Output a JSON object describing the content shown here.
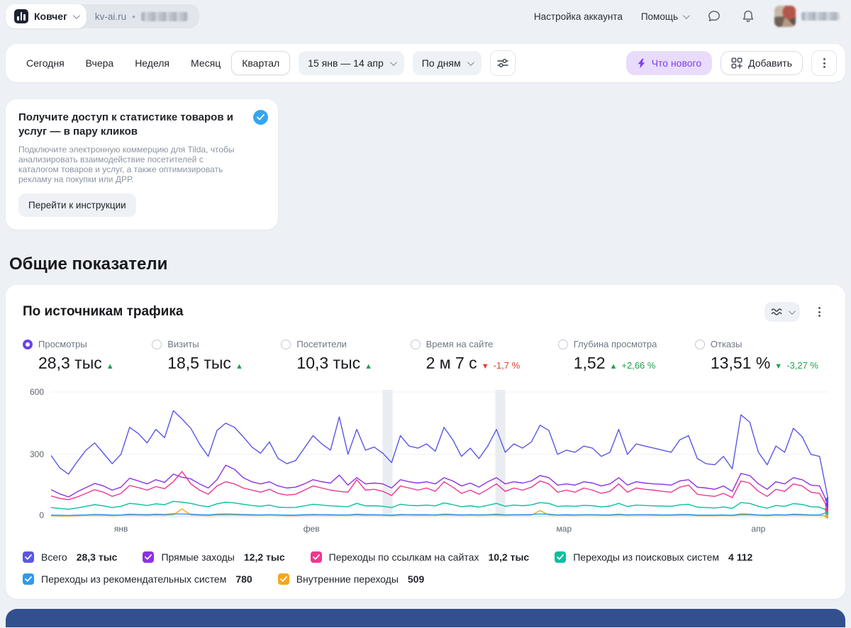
{
  "header": {
    "counter_name": "Ковчег",
    "site_url": "kv-ai.ru",
    "separator": "•",
    "account_settings_label": "Настройка аккаунта",
    "help_label": "Помощь"
  },
  "toolbar": {
    "periods": [
      "Сегодня",
      "Вчера",
      "Неделя",
      "Месяц",
      "Квартал"
    ],
    "selected_period": "Квартал",
    "date_range_label": "15 янв — 14 апр",
    "granularity_label": "По дням",
    "whats_new_label": "Что нового",
    "add_label": "Добавить"
  },
  "promo": {
    "title": "Получите доступ к статистике товаров и услуг — в пару кликов",
    "body": "Подключите электронную коммерцию для Tilda, чтобы анализировать взаимодействие посетителей с каталогом товаров и услуг, а также оптимизировать рекламу на покупки или ДРР.",
    "cta_label": "Перейти к инструкции"
  },
  "section_title": "Общие показатели",
  "chart_card": {
    "title": "По источникам трафика",
    "metrics": [
      {
        "label": "Просмотры",
        "value": "28,3 тыс",
        "arrow": "▲",
        "delta": ""
      },
      {
        "label": "Визиты",
        "value": "18,5 тыс",
        "arrow": "▲",
        "delta": ""
      },
      {
        "label": "Посетители",
        "value": "10,3 тыс",
        "arrow": "▲",
        "delta": ""
      },
      {
        "label": "Время на сайте",
        "value": "2 м 7 с",
        "arrow": "▼",
        "delta": "-1,7 %"
      },
      {
        "label": "Глубина просмотра",
        "value": "1,52",
        "arrow": "▲",
        "delta": "+2,66 %"
      },
      {
        "label": "Отказы",
        "value": "13,51 %",
        "arrow": "▼",
        "delta": "-3,27 %"
      }
    ],
    "legend": [
      {
        "label": "Всего",
        "value": "28,3 тыс",
        "color": "#5b57e8"
      },
      {
        "label": "Прямые заходы",
        "value": "12,2 тыс",
        "color": "#8c32e3"
      },
      {
        "label": "Переходы по ссылкам на сайтах",
        "value": "10,2 тыс",
        "color": "#f0368f"
      },
      {
        "label": "Переходы из поисковых систем",
        "value": "4 112",
        "color": "#0cbf9f"
      },
      {
        "label": "Переходы из рекомендательных систем",
        "value": "780",
        "color": "#2d9bf0"
      },
      {
        "label": "Внутренние переходы",
        "value": "509",
        "color": "#f5a71f"
      }
    ]
  },
  "chart_data": {
    "type": "line",
    "title": "По источникам трафика",
    "x_range": "15 янв — 14 апр, по дням",
    "ylim": [
      0,
      600
    ],
    "yticks": [
      600,
      300,
      0
    ],
    "xticks": [
      "янв",
      "фев",
      "мар",
      "апр"
    ],
    "xtick_fracs": [
      0.09,
      0.335,
      0.66,
      0.91
    ],
    "holiday_band_fracs": [
      0.433,
      0.578
    ],
    "grid": true,
    "legend_position": "bottom",
    "series": [
      {
        "name": "Всего",
        "total": "28,3 тыс",
        "color": "#5b57e8",
        "values": [
          295,
          235,
          205,
          265,
          320,
          355,
          305,
          255,
          300,
          430,
          400,
          355,
          420,
          380,
          510,
          470,
          425,
          350,
          290,
          415,
          450,
          430,
          385,
          335,
          305,
          360,
          280,
          255,
          270,
          330,
          390,
          350,
          320,
          480,
          300,
          420,
          320,
          335,
          305,
          260,
          390,
          340,
          330,
          350,
          315,
          430,
          370,
          290,
          330,
          280,
          340,
          420,
          310,
          350,
          330,
          360,
          440,
          415,
          300,
          320,
          310,
          340,
          330,
          290,
          310,
          420,
          300,
          350,
          340,
          330,
          320,
          310,
          370,
          390,
          280,
          255,
          250,
          290,
          230,
          490,
          455,
          310,
          250,
          340,
          310,
          425,
          385,
          300,
          290,
          80
        ]
      },
      {
        "name": "Прямые заходы",
        "total": "12,2 тыс",
        "color": "#8c32e3",
        "values": [
          130,
          110,
          95,
          120,
          140,
          160,
          148,
          128,
          142,
          185,
          172,
          158,
          178,
          165,
          205,
          190,
          182,
          158,
          138,
          178,
          248,
          228,
          188,
          168,
          158,
          168,
          148,
          138,
          142,
          158,
          178,
          168,
          162,
          200,
          152,
          188,
          158,
          162,
          158,
          138,
          178,
          168,
          162,
          168,
          158,
          188,
          172,
          148,
          162,
          142,
          168,
          188,
          158,
          168,
          162,
          172,
          198,
          188,
          152,
          158,
          152,
          168,
          162,
          148,
          158,
          188,
          152,
          168,
          162,
          158,
          156,
          152,
          172,
          178,
          142,
          138,
          132,
          148,
          122,
          208,
          198,
          158,
          132,
          168,
          158,
          188,
          178,
          152,
          148,
          58
        ]
      },
      {
        "name": "Переходы по ссылкам на сайтах",
        "total": "10,2 тыс",
        "color": "#f0368f",
        "values": [
          100,
          88,
          82,
          95,
          112,
          130,
          118,
          98,
          112,
          150,
          140,
          128,
          145,
          135,
          168,
          218,
          158,
          128,
          108,
          148,
          168,
          158,
          138,
          128,
          118,
          132,
          112,
          104,
          108,
          128,
          148,
          138,
          128,
          122,
          118,
          178,
          128,
          132,
          122,
          102,
          148,
          138,
          128,
          138,
          122,
          168,
          142,
          112,
          128,
          108,
          132,
          158,
          122,
          138,
          128,
          142,
          172,
          158,
          118,
          128,
          118,
          138,
          128,
          112,
          122,
          158,
          118,
          138,
          132,
          128,
          122,
          118,
          142,
          152,
          108,
          102,
          98,
          112,
          92,
          172,
          162,
          122,
          98,
          132,
          122,
          158,
          148,
          118,
          112,
          38
        ]
      },
      {
        "name": "Переходы из поисковых систем",
        "total": "4 112",
        "color": "#0cbf9f",
        "values": [
          44,
          40,
          36,
          42,
          50,
          58,
          52,
          44,
          50,
          64,
          60,
          54,
          62,
          58,
          74,
          70,
          64,
          54,
          48,
          62,
          70,
          66,
          60,
          54,
          50,
          56,
          46,
          44,
          45,
          52,
          60,
          56,
          52,
          50,
          48,
          64,
          52,
          53,
          50,
          44,
          60,
          55,
          53,
          56,
          52,
          66,
          58,
          48,
          53,
          46,
          55,
          64,
          50,
          56,
          53,
          57,
          68,
          64,
          49,
          52,
          50,
          55,
          53,
          47,
          51,
          64,
          49,
          56,
          54,
          52,
          51,
          50,
          57,
          60,
          46,
          44,
          42,
          47,
          40,
          68,
          64,
          50,
          41,
          54,
          50,
          63,
          59,
          48,
          46,
          28
        ]
      },
      {
        "name": "Переходы из рекомендательных систем",
        "total": "780",
        "color": "#2d9bf0",
        "values": [
          8,
          7,
          6,
          8,
          9,
          11,
          10,
          8,
          9,
          12,
          11,
          10,
          12,
          11,
          14,
          13,
          12,
          10,
          9,
          12,
          13,
          12,
          11,
          10,
          9,
          10,
          9,
          8,
          8,
          10,
          11,
          10,
          10,
          9,
          9,
          12,
          10,
          10,
          9,
          8,
          11,
          10,
          10,
          10,
          9,
          12,
          11,
          9,
          10,
          9,
          10,
          12,
          9,
          10,
          10,
          11,
          13,
          12,
          9,
          10,
          9,
          10,
          10,
          9,
          9,
          12,
          9,
          10,
          10,
          10,
          9,
          9,
          11,
          11,
          8,
          8,
          8,
          9,
          7,
          13,
          12,
          9,
          8,
          10,
          9,
          12,
          11,
          9,
          9,
          22
        ]
      },
      {
        "name": "Внутренние переходы",
        "total": "509",
        "color": "#f5a71f",
        "values": [
          5,
          4,
          4,
          5,
          6,
          7,
          6,
          5,
          6,
          8,
          7,
          6,
          8,
          7,
          9,
          38,
          8,
          6,
          5,
          8,
          9,
          8,
          7,
          6,
          6,
          7,
          6,
          5,
          5,
          6,
          7,
          7,
          6,
          6,
          6,
          8,
          6,
          7,
          6,
          5,
          7,
          7,
          6,
          7,
          6,
          8,
          7,
          6,
          7,
          6,
          7,
          8,
          6,
          7,
          7,
          7,
          30,
          8,
          6,
          6,
          6,
          7,
          7,
          6,
          6,
          8,
          6,
          7,
          7,
          6,
          6,
          6,
          7,
          7,
          5,
          5,
          5,
          6,
          5,
          8,
          8,
          6,
          5,
          7,
          6,
          8,
          7,
          6,
          6,
          3
        ]
      }
    ]
  }
}
